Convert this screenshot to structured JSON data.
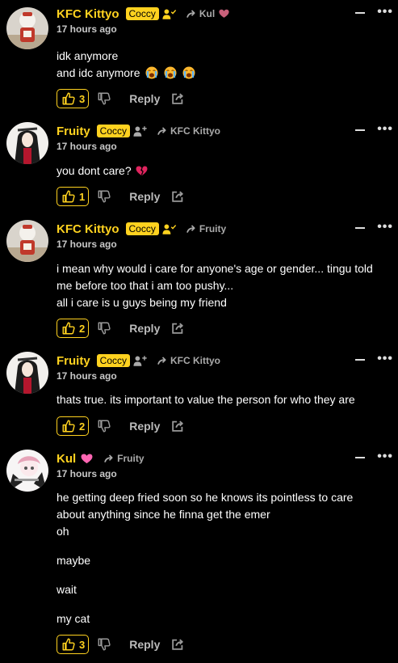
{
  "colors": {
    "accent": "#ffd21f",
    "background": "#000000",
    "muted": "#aaaaaa",
    "heart": "#c8607a",
    "pink_heart": "#ff66b3"
  },
  "ui": {
    "reply_label": "Reply",
    "more_label": "•••"
  },
  "comments": [
    {
      "username": "KFC Kittyo",
      "badge": "Coccy",
      "follow_icon": "person-check-icon",
      "reply_to": "Kul",
      "reply_to_heart": "heart-icon",
      "time": "17 hours ago",
      "lines": [
        "idk anymore",
        "and idc anymore"
      ],
      "emojis": [
        "loudly-crying-face",
        "loudly-crying-face",
        "loudly-crying-face"
      ],
      "likes": "3"
    },
    {
      "username": "Fruity",
      "badge": "Coccy",
      "follow_icon": "person-add-icon",
      "reply_to": "KFC Kittyo",
      "time": "17 hours ago",
      "lines": [
        "you dont care?"
      ],
      "emojis": [
        "broken-heart"
      ],
      "likes": "1"
    },
    {
      "username": "KFC Kittyo",
      "badge": "Coccy",
      "follow_icon": "person-check-icon",
      "reply_to": "Fruity",
      "time": "17 hours ago",
      "lines": [
        "i mean why would i care for anyone's age or gender... tingu told",
        "me before too that i am too pushy...",
        "all i care is u guys being my friend"
      ],
      "likes": "2"
    },
    {
      "username": "Fruity",
      "badge": "Coccy",
      "follow_icon": "person-add-icon",
      "reply_to": "KFC Kittyo",
      "time": "17 hours ago",
      "lines": [
        "thats true. its important to value the person for who they are"
      ],
      "likes": "2"
    },
    {
      "username": "Kul",
      "name_heart": "pink-heart-icon",
      "reply_to": "Fruity",
      "time": "17 hours ago",
      "lines": [
        "he getting deep fried soon so he knows its pointless to care",
        "about anything since he finna get the emer",
        "oh",
        "",
        "maybe",
        "",
        "wait",
        "",
        "my cat"
      ],
      "likes": "3"
    }
  ]
}
